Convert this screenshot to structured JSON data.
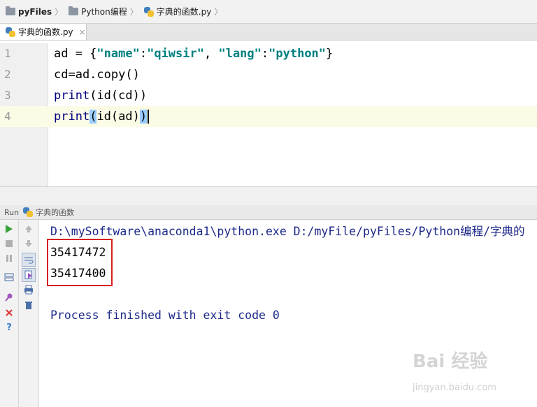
{
  "breadcrumb": {
    "items": [
      "pyFiles",
      "Python编程",
      "字典的函数.py"
    ]
  },
  "tabs": [
    {
      "label": "字典的函数.py",
      "close": "×"
    }
  ],
  "editor": {
    "lines": [
      {
        "number": "1",
        "code": "ad = {\"name\":\"qiwsir\", \"lang\":\"python\"}"
      },
      {
        "number": "2",
        "code": "cd=ad.copy()"
      },
      {
        "number": "3",
        "code": "print(id(cd))"
      },
      {
        "number": "4",
        "code": "print(id(ad))"
      }
    ],
    "current_line": 4
  },
  "run": {
    "title": "Run",
    "config_name": "字典的函数",
    "command": "D:\\mySoftware\\anaconda1\\python.exe D:/myFile/pyFiles/Python编程/字典的",
    "output": [
      "35417472",
      "35417400"
    ],
    "exit_message": "Process finished with exit code 0"
  },
  "watermark": {
    "logo": "Bai 经验",
    "url": "jingyan.baidu.com"
  },
  "colors": {
    "highlight_box": "#d81e1e",
    "current_line": "#fcfbe6",
    "console_text": "#1e2a8a"
  }
}
